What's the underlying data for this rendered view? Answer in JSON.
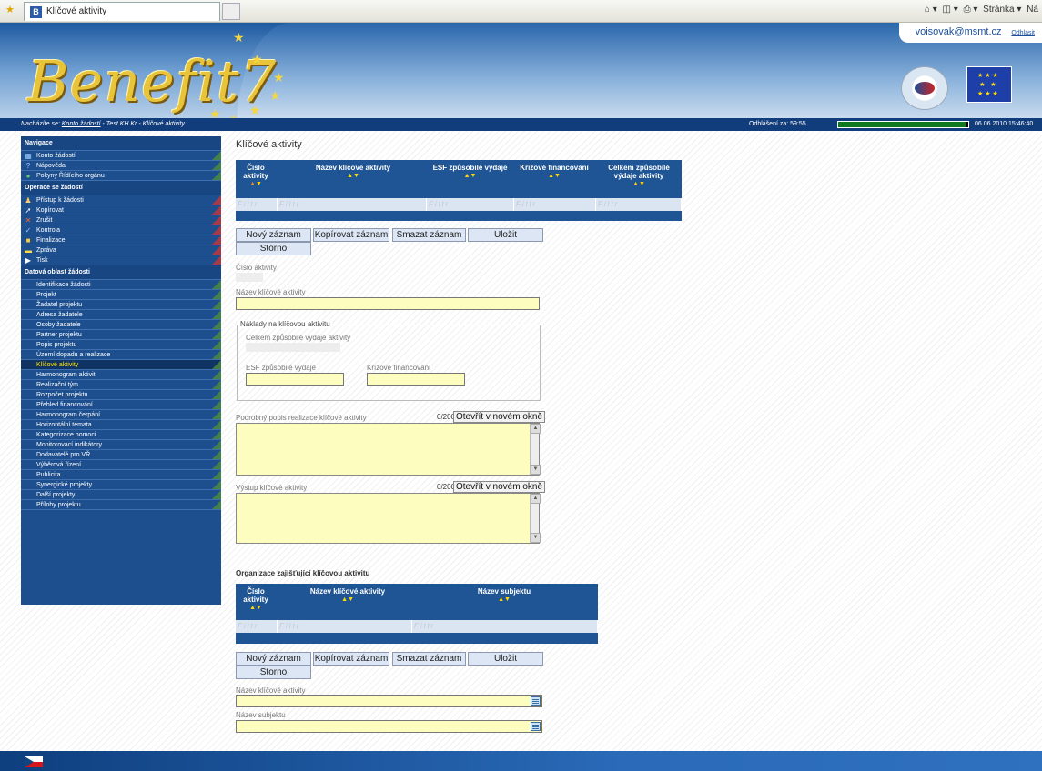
{
  "browser": {
    "tab_title": "Klíčové aktivity",
    "tab_icon_letter": "B",
    "tools": [
      "Stránka ▾",
      "Ná"
    ]
  },
  "header": {
    "logo_text": "Benefit7",
    "user_email": "voisovak@msmt.cz",
    "logout_label": "Odhlásit"
  },
  "status": {
    "breadcrumb_prefix": "Nacházíte se:",
    "breadcrumb_link": "Konto žádostí",
    "breadcrumb_rest": " - Test KH Kr - Klíčové aktivity",
    "logout_timer": "Odhlášení za: 59:55",
    "datetime": "06.06.2010 15:46:40",
    "session_remaining": 0.98
  },
  "sidebar": {
    "sections": [
      {
        "title": "Navigace",
        "items": [
          {
            "label": "Konto žádostí",
            "icon": "account-icon"
          },
          {
            "label": "Nápověda",
            "icon": "help-icon"
          },
          {
            "label": "Pokyny Řídícího orgánu",
            "icon": "info-icon"
          }
        ]
      },
      {
        "title": "Operace se žádostí",
        "items": [
          {
            "label": "Přístup k žádosti",
            "icon": "users-icon"
          },
          {
            "label": "Kopírovat",
            "icon": "copy-arrow-icon"
          },
          {
            "label": "Zrušit",
            "icon": "cancel-x-icon"
          },
          {
            "label": "Kontrola",
            "icon": "check-icon"
          },
          {
            "label": "Finalizace",
            "icon": "lock-icon"
          },
          {
            "label": "Zpráva",
            "icon": "message-icon"
          },
          {
            "label": "Tisk",
            "icon": "print-icon"
          }
        ]
      },
      {
        "title": "Datová oblast žádosti",
        "items": [
          {
            "label": "Identifikace žádosti"
          },
          {
            "label": "Projekt"
          },
          {
            "label": "Žadatel projektu"
          },
          {
            "label": "Adresa žadatele"
          },
          {
            "label": "Osoby žadatele"
          },
          {
            "label": "Partner projektu"
          },
          {
            "label": "Popis projektu"
          },
          {
            "label": "Území dopadu a realizace"
          },
          {
            "label": "Klíčové aktivity",
            "active": true
          },
          {
            "label": "Harmonogram aktivit"
          },
          {
            "label": "Realizační tým"
          },
          {
            "label": "Rozpočet projektu"
          },
          {
            "label": "Přehled financování"
          },
          {
            "label": "Harmonogram čerpání"
          },
          {
            "label": "Horizontální témata"
          },
          {
            "label": "Kategorizace pomoci"
          },
          {
            "label": "Monitorovací indikátory"
          },
          {
            "label": "Dodavatelé pro VŘ"
          },
          {
            "label": "Výběrová řízení"
          },
          {
            "label": "Publicita"
          },
          {
            "label": "Synergické projekty"
          },
          {
            "label": "Další projekty"
          },
          {
            "label": "Přílohy projektu"
          }
        ]
      }
    ]
  },
  "main": {
    "page_title": "Klíčové aktivity",
    "grid1": {
      "columns": [
        "Číslo aktivity",
        "Název klíčové aktivity",
        "ESF způsobilé výdaje",
        "Křížové financování",
        "Celkem způsobilé výdaje aktivity"
      ],
      "filter_placeholder": "Filtr"
    },
    "buttons": {
      "new": "Nový záznam",
      "copy": "Kopírovat záznam",
      "delete": "Smazat záznam",
      "save": "Uložit",
      "cancel": "Storno"
    },
    "form": {
      "activity_number_label": "Číslo aktivity",
      "activity_name_label": "Název klíčové aktivity",
      "costs_legend": "Náklady na klíčovou aktivitu",
      "total_label": "Celkem způsobilé výdaje aktivity",
      "esf_label": "ESF způsobilé výdaje",
      "cross_label": "Křížové financování",
      "description_label": "Podrobný popis realizace klíčové aktivity",
      "description_counter": "0/2000",
      "output_label": "Výstup klíčové aktivity",
      "output_counter": "0/2000",
      "open_window_label": "Otevřít v novém okně"
    },
    "org": {
      "title": "Organizace zajišťující klíčovou aktivitu",
      "columns": [
        "Číslo aktivity",
        "Název klíčové aktivity",
        "Název subjektu"
      ],
      "activity_label": "Název klíčové aktivity",
      "subject_label": "Název subjektu"
    }
  },
  "colors": {
    "nav_blue": "#1d4f8f",
    "grid_blue": "#1f5594",
    "input_yellow": "#fefdc0",
    "active_item": "#ffe400"
  }
}
